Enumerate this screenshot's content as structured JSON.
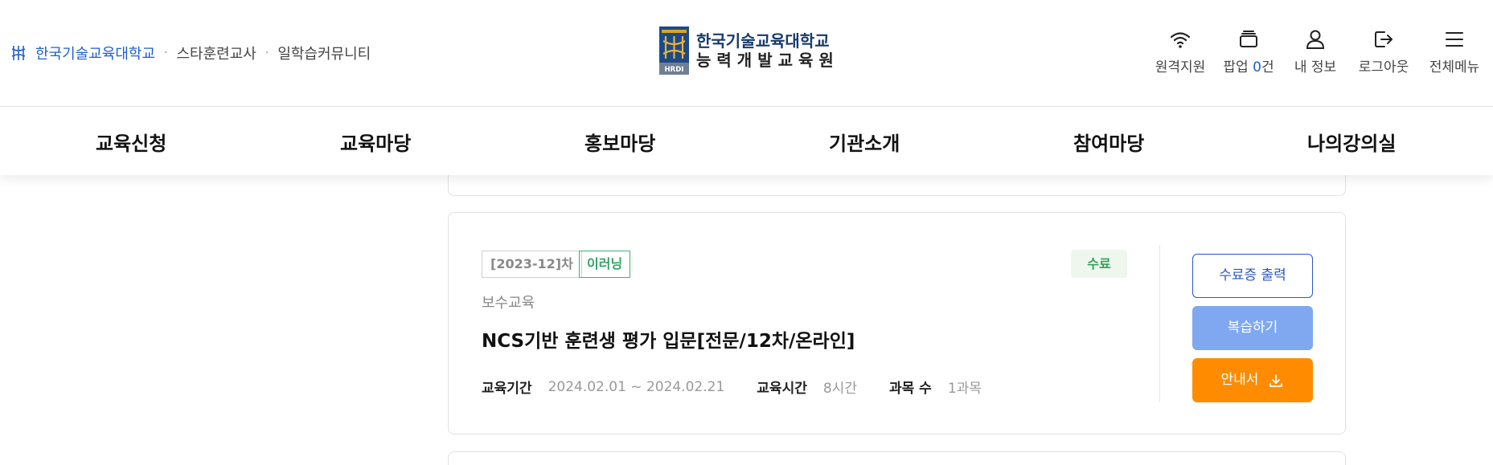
{
  "header": {
    "family_links": {
      "main": "한국기술교육대학교",
      "items": [
        "스타훈련교사",
        "일학습커뮤니티"
      ]
    },
    "brand": {
      "line1": "한국기술교육대학교",
      "line2": "능력개발교육원",
      "emblem_text": "HRDI"
    },
    "util_menu": [
      {
        "icon": "wifi-icon",
        "label": "원격지원"
      },
      {
        "icon": "popup-icon",
        "label_prefix": "팝업 ",
        "count": "0",
        "label_suffix": "건"
      },
      {
        "icon": "user-icon",
        "label": "내 정보"
      },
      {
        "icon": "logout-icon",
        "label": "로그아웃"
      },
      {
        "icon": "menu-icon",
        "label": "전체메뉴"
      }
    ]
  },
  "gnb": {
    "items": [
      "교육신청",
      "교육마당",
      "홍보마당",
      "기관소개",
      "참여마당",
      "나의강의실"
    ]
  },
  "course_card": {
    "round": "[2023-12]차",
    "type": "이러닝",
    "status": "수료",
    "category": "보수교육",
    "title": "NCS기반 훈련생 평가 입문[전문/12차/온라인]",
    "meta": {
      "period_label": "교육기간",
      "period_value": "2024.02.01 ~ 2024.02.21",
      "hours_label": "교육시간",
      "hours_value": "8시간",
      "subjects_label": "과목 수",
      "subjects_value": "1과목"
    },
    "buttons": {
      "certificate": "수료증 출력",
      "review": "복습하기",
      "guide": "안내서"
    }
  },
  "colors": {
    "primary_blue": "#1f5fd1",
    "button_blue": "#2c57c9",
    "review_blue": "#7fa8f0",
    "guide_orange": "#ff8c00",
    "elearning_green": "#2ea464",
    "brand_navy": "#173b6b"
  }
}
